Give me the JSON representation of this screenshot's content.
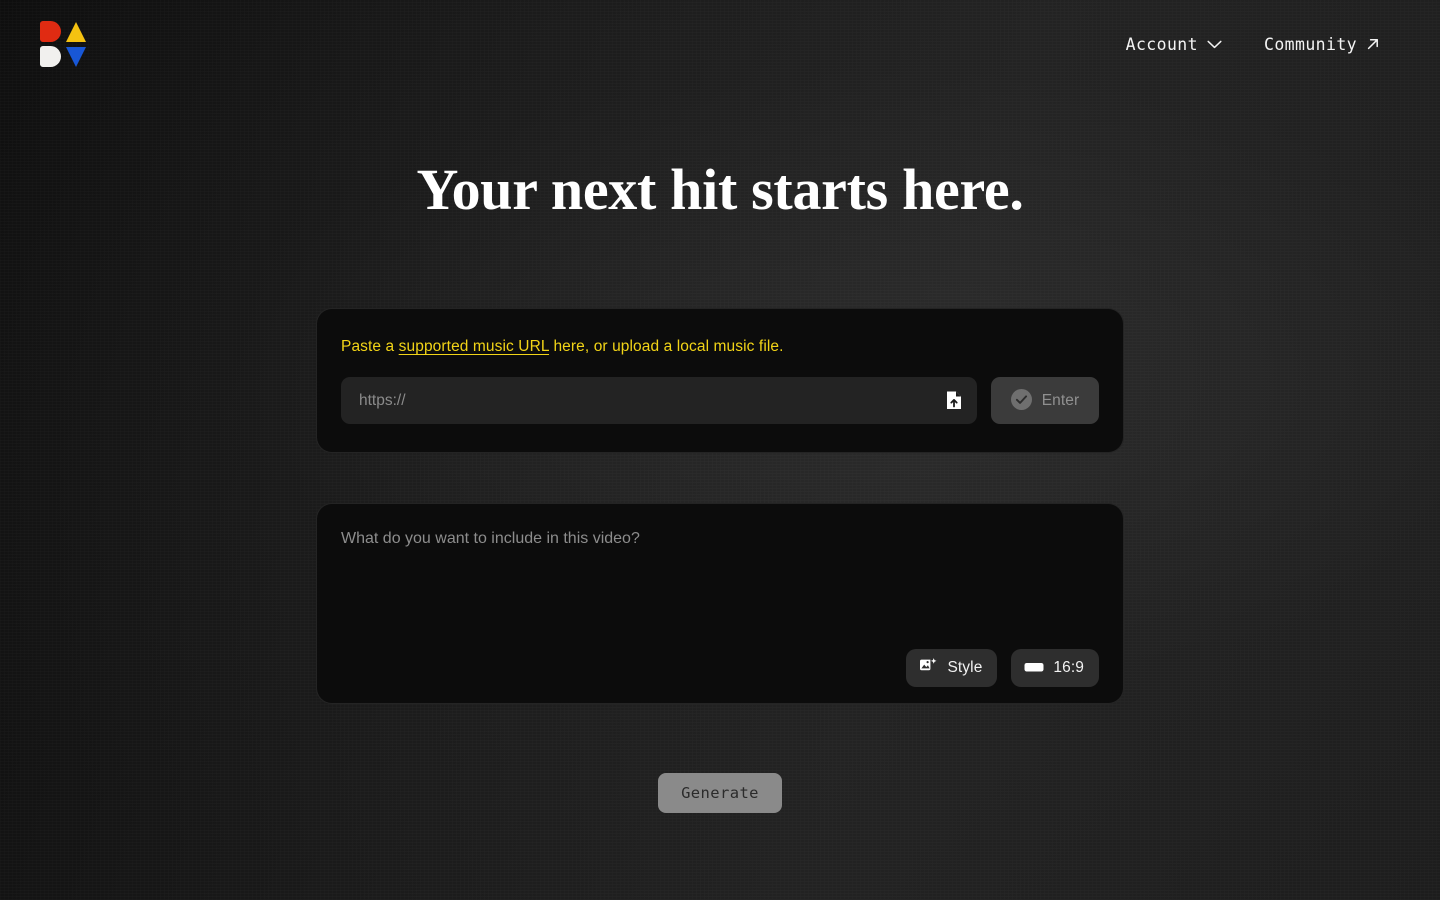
{
  "header": {
    "logo": {
      "name": "app-logo",
      "tiles": [
        {
          "shape": "d-shape",
          "color": "#e02b12"
        },
        {
          "shape": "triangle-up",
          "color": "#f5c211"
        },
        {
          "shape": "d-shape",
          "color": "#f1f0ee"
        },
        {
          "shape": "triangle-down",
          "color": "#1857d6"
        }
      ]
    },
    "nav": [
      {
        "label": "Account",
        "icon": "chevron-down-icon"
      },
      {
        "label": "Community",
        "icon": "arrow-up-right-icon"
      }
    ]
  },
  "hero": {
    "headline": "Your next hit starts here."
  },
  "url_panel": {
    "hint_prefix": "Paste a ",
    "hint_link": "supported music URL",
    "hint_suffix": " here, or upload a local music file.",
    "input": {
      "placeholder": "https://",
      "value": "",
      "upload_icon": "file-upload-icon"
    },
    "enter_button": {
      "label": "Enter",
      "icon": "check-circle-icon",
      "disabled": true
    }
  },
  "prompt_panel": {
    "input": {
      "placeholder": "What do you want to include in this video?",
      "value": ""
    },
    "tools": [
      {
        "label": "Style",
        "icon": "image-add-icon"
      },
      {
        "label": "16:9",
        "icon": "aspect-ratio-icon"
      }
    ]
  },
  "footer_action": {
    "generate_label": "Generate",
    "disabled": true
  },
  "colors": {
    "page_background": "#1b1b1b",
    "panel_background": "#0c0c0c",
    "panel_border": "rgba(255,255,255,0.10)",
    "accent_yellow": "#f2d417",
    "input_background": "#232323",
    "tool_background": "#2e2e2e",
    "enter_background": "#3b3b3b",
    "generate_background": "#8a8a8a",
    "logo_red": "#e02b12",
    "logo_yellow": "#f5c211",
    "logo_white": "#f1f0ee",
    "logo_blue": "#1857d6"
  }
}
